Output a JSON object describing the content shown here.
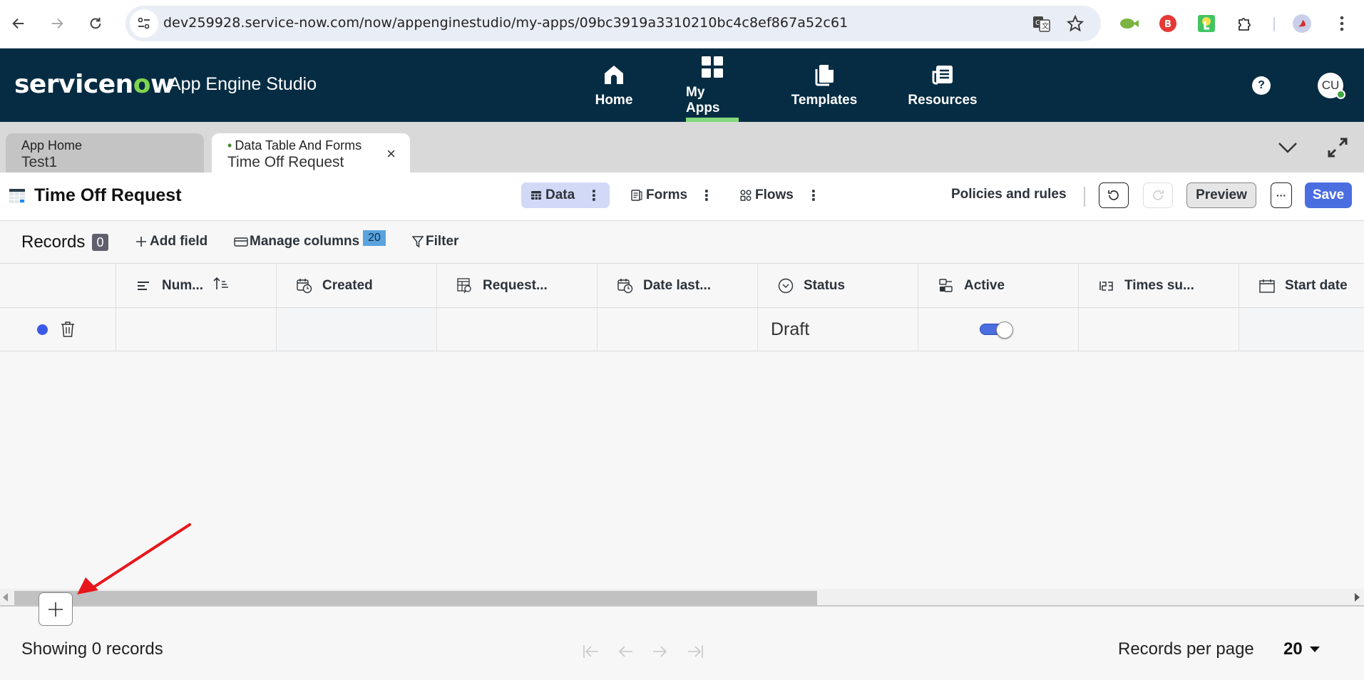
{
  "browser": {
    "url": "dev259928.service-now.com/now/appenginestudio/my-apps/09bc3919a3310210bc4c8ef867a52c61",
    "back_icon": "arrow-left-icon",
    "forward_icon": "arrow-right-icon",
    "reload_icon": "reload-icon",
    "site_info_icon": "tune-icon",
    "translate_icon": "translate-icon",
    "bookmark_icon": "star-icon",
    "extensions": [
      "green-camera-extension-icon",
      "red-b-extension-icon",
      "touch-extension-icon",
      "puzzle-extensions-icon"
    ],
    "profile_icon": "bird-avatar-icon",
    "menu_icon": "kebab-menu-icon"
  },
  "appbar": {
    "logo_text_a": "servicen",
    "logo_text_o": "o",
    "logo_text_b": "w",
    "title": "App Engine Studio",
    "nav": [
      {
        "label": "Home",
        "icon": "home-icon",
        "active": false
      },
      {
        "label": "My Apps",
        "icon": "grid-apps-icon",
        "active": true
      },
      {
        "label": "Templates",
        "icon": "documents-icon",
        "active": false
      },
      {
        "label": "Resources",
        "icon": "newspaper-icon",
        "active": false
      }
    ],
    "help_label": "?",
    "avatar_initials": "CU",
    "accent_color": "#81d97c"
  },
  "tabs": [
    {
      "sub": "App Home",
      "main": "Test1",
      "active": false
    },
    {
      "sub": "Data Table And Forms",
      "main": "Time Off Request",
      "active": true,
      "close_label": "×"
    }
  ],
  "titlebar": {
    "title": "Time Off Request",
    "views": [
      {
        "label": "Data",
        "selected": true
      },
      {
        "label": "Forms",
        "selected": false
      },
      {
        "label": "Flows",
        "selected": false
      }
    ],
    "policies_label": "Policies and rules",
    "preview_label": "Preview",
    "more_label": "···",
    "save_label": "Save",
    "save_color": "#4a6ee0"
  },
  "records_bar": {
    "label": "Records",
    "count": "0",
    "add_field_label": "Add field",
    "manage_columns_label": "Manage columns",
    "manage_columns_badge": "20",
    "filter_label": "Filter"
  },
  "table": {
    "columns": [
      {
        "label": "Num...",
        "icon": "string-field-icon",
        "sorted": "ascending"
      },
      {
        "label": "Created",
        "icon": "calendar-clock-icon"
      },
      {
        "label": "Request...",
        "icon": "table-reference-icon"
      },
      {
        "label": "Date last...",
        "icon": "calendar-clock-icon"
      },
      {
        "label": "Status",
        "icon": "choice-dropdown-icon"
      },
      {
        "label": "Active",
        "icon": "true-false-icon"
      },
      {
        "label": "Times su...",
        "icon": "integer-123-icon"
      },
      {
        "label": "Start date",
        "icon": "calendar-icon"
      }
    ],
    "rows": [
      {
        "indicator": "new-record-dot",
        "number": "",
        "created": "",
        "requested_for": "",
        "date_last": "",
        "status": "Draft",
        "active": true,
        "times_submitted": "",
        "start_date": ""
      }
    ]
  },
  "footer": {
    "showing_text": "Showing 0 records",
    "pager": [
      "first-page-icon",
      "prev-page-icon",
      "next-page-icon",
      "last-page-icon"
    ],
    "records_per_page_label": "Records per page",
    "records_per_page_value": "20"
  },
  "add_row_label": "+"
}
